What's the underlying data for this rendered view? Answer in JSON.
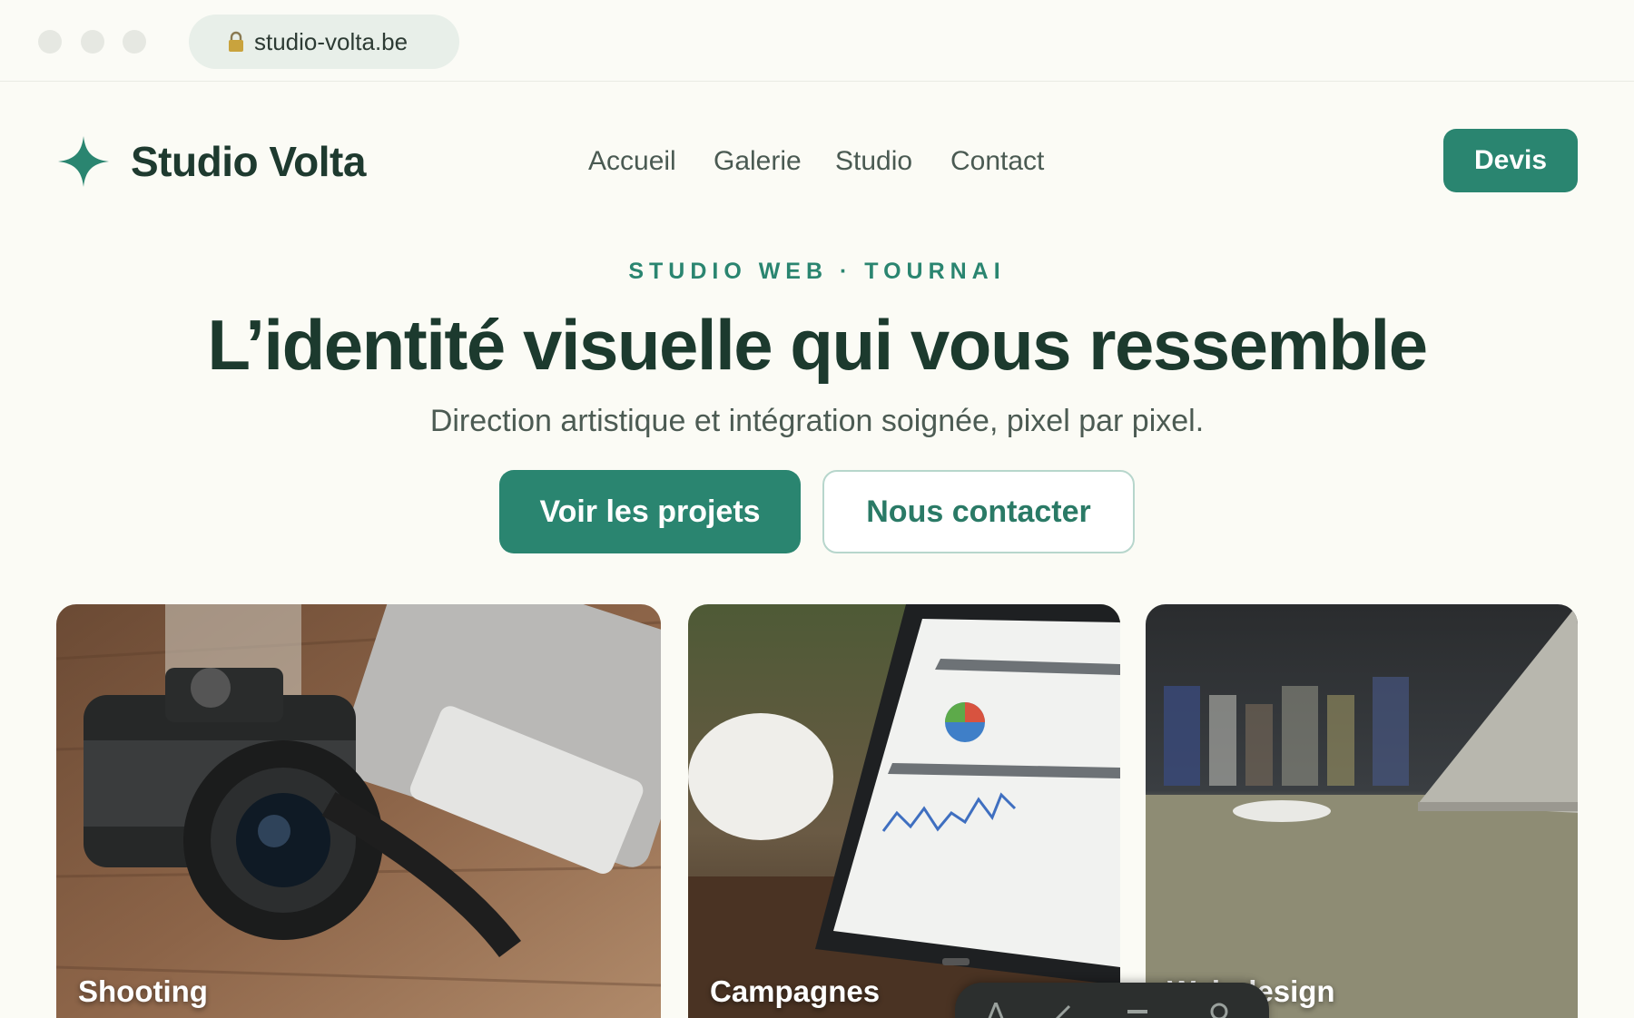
{
  "browser": {
    "url": "studio-volta.be",
    "lock_icon": "lock-icon"
  },
  "header": {
    "brand": "Studio Volta",
    "logo_icon": "sparkle-star-icon",
    "nav": [
      "Accueil",
      "Galerie",
      "Studio",
      "Contact"
    ],
    "cta": "Devis"
  },
  "hero": {
    "eyebrow": "STUDIO WEB · TOURNAI",
    "title": "L’identité visuelle qui vous ressemble",
    "subtitle": "Direction artistique et intégration soignée, pixel par pixel.",
    "primary_button": "Voir les projets",
    "secondary_button": "Nous contacter"
  },
  "cards": [
    {
      "label": "Shooting",
      "image": "camera-on-wooden-desk"
    },
    {
      "label": "Campagnes",
      "image": "tablet-with-analytics-dashboard"
    },
    {
      "label": "Web design",
      "image": "laptop-and-mouse-on-desk"
    }
  ],
  "colors": {
    "accent": "#2a8570",
    "heading": "#1c3a2e",
    "background": "#fbfbf5"
  }
}
